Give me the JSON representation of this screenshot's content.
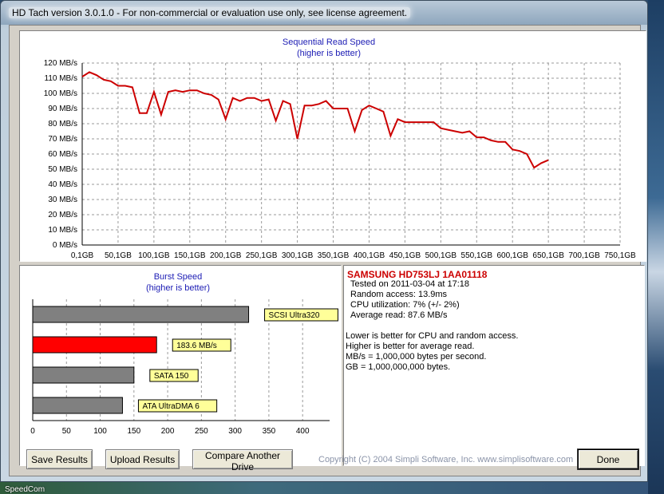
{
  "window": {
    "title": "HD Tach version 3.0.1.0  - For non-commercial or evaluation use only, see license agreement."
  },
  "desktop": {
    "label": "SpeedCom"
  },
  "sequential_chart_title": [
    "Sequential Read Speed",
    "(higher is better)"
  ],
  "burst_chart_title": [
    "Burst Speed",
    "(higher is better)"
  ],
  "chart_data": [
    {
      "type": "line",
      "title": "Sequential Read Speed",
      "subtitle": "(higher is better)",
      "y_ticks": [
        "0 MB/s",
        "10 MB/s",
        "20 MB/s",
        "30 MB/s",
        "40 MB/s",
        "50 MB/s",
        "60 MB/s",
        "70 MB/s",
        "80 MB/s",
        "90 MB/s",
        "100 MB/s",
        "110 MB/s",
        "120 MB/s"
      ],
      "x_ticks": [
        "0,1GB",
        "50,1GB",
        "100,1GB",
        "150,1GB",
        "200,1GB",
        "250,1GB",
        "300,1GB",
        "350,1GB",
        "400,1GB",
        "450,1GB",
        "500,1GB",
        "550,1GB",
        "600,1GB",
        "650,1GB",
        "700,1GB",
        "750,1GB"
      ],
      "ylim": [
        0,
        120
      ],
      "xlim": [
        0,
        750
      ],
      "grid": true,
      "series": [
        {
          "color": "#cc0000",
          "x": [
            0,
            10,
            20,
            30,
            40,
            50,
            60,
            70,
            80,
            90,
            100,
            110,
            120,
            130,
            140,
            150,
            160,
            170,
            180,
            190,
            200,
            210,
            220,
            230,
            240,
            250,
            260,
            270,
            280,
            290,
            300,
            310,
            320,
            330,
            340,
            350,
            360,
            370,
            380,
            390,
            400,
            410,
            420,
            430,
            440,
            450,
            460,
            470,
            480,
            490,
            500,
            510,
            520,
            530,
            540,
            550,
            560,
            570,
            580,
            590,
            600,
            610,
            620,
            630,
            640,
            650,
            660,
            670,
            680,
            690,
            700,
            710,
            720,
            730,
            740,
            750
          ],
          "y": [
            111,
            114,
            112,
            109,
            108,
            105,
            105,
            104,
            87,
            87,
            101,
            86,
            101,
            102,
            101,
            102,
            102,
            100,
            99,
            96,
            83,
            97,
            95,
            97,
            97,
            95,
            96,
            82,
            95,
            93,
            70,
            92,
            92,
            93,
            95,
            90,
            90,
            90,
            75,
            89,
            92,
            90,
            88,
            72,
            83,
            81,
            81,
            81,
            81,
            81,
            77,
            76,
            75,
            74,
            75,
            71,
            71,
            69,
            68,
            68,
            63,
            62,
            60,
            51,
            54,
            56,
            null,
            null,
            null,
            null,
            null,
            null,
            null,
            null,
            null,
            null
          ]
        }
      ]
    },
    {
      "type": "bar",
      "orientation": "horizontal",
      "title": "Burst Speed",
      "subtitle": "(higher is better)",
      "x_ticks": [
        "0",
        "50",
        "100",
        "150",
        "200",
        "250",
        "300",
        "350",
        "400"
      ],
      "xlim": [
        0,
        440
      ],
      "grid": true,
      "categories": [
        "SCSI Ultra320",
        "183.6 MB/s",
        "SATA 150",
        "ATA UltraDMA 6"
      ],
      "values": [
        320,
        183.6,
        150,
        133
      ],
      "colors": [
        "#808080",
        "#ff0000",
        "#808080",
        "#808080"
      ]
    }
  ],
  "info": {
    "drive": "SAMSUNG HD753LJ 1AA01118",
    "tested": "Tested on 2011-03-04 at 17:18",
    "random_access": "Random access: 13.9ms",
    "cpu": "CPU utilization: 7% (+/- 2%)",
    "average_read": "Average read: 87.6 MB/s",
    "notes": [
      "Lower is better for CPU and random access.",
      "Higher is better for average read.",
      "MB/s = 1,000,000 bytes per second.",
      "GB = 1,000,000,000 bytes."
    ]
  },
  "buttons": {
    "save": "Save Results",
    "upload": "Upload Results",
    "compare": "Compare Another Drive",
    "done": "Done"
  },
  "copyright": "Copyright (C) 2004 Simpli Software, Inc. www.simplisoftware.com"
}
